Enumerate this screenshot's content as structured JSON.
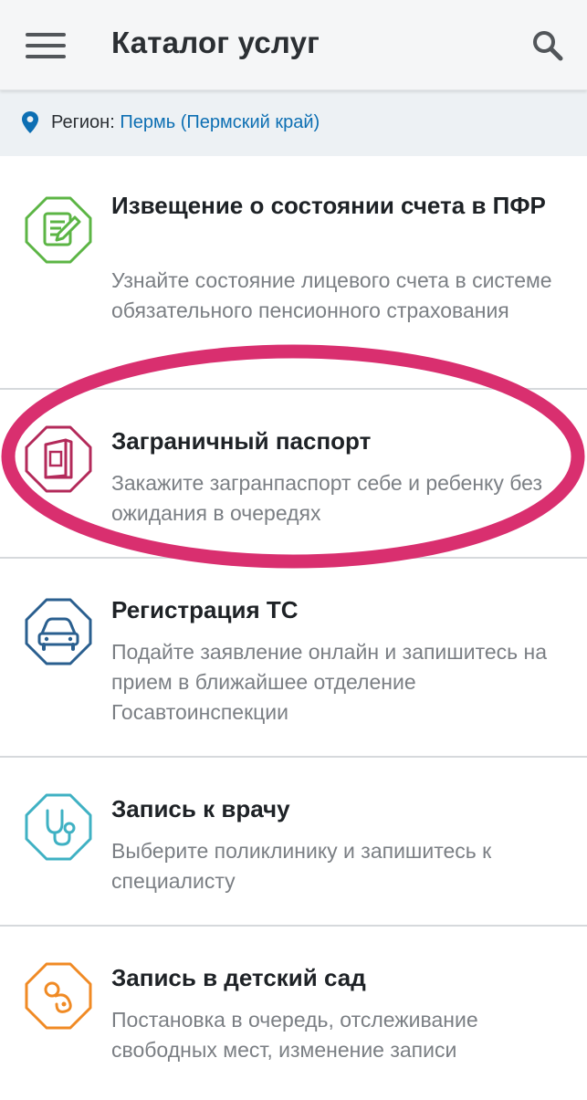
{
  "appbar": {
    "menu_icon": "hamburger-menu-icon",
    "title": "Каталог услуг",
    "search_icon": "search-icon"
  },
  "region": {
    "icon": "location-pin-icon",
    "label": "Регион:",
    "value": "Пермь (Пермский край)"
  },
  "services": [
    {
      "title": "Извещение о состоянии счета в ПФР",
      "description": "Узнайте состояние лицевого счета в системе обязательного пенсионного страхования",
      "icon": "document-edit-icon",
      "color": "#5cb545"
    },
    {
      "title": "Заграничный паспорт",
      "description": "Закажите загранпаспорт себе и ребенку без ожидания в очередях",
      "icon": "passport-icon",
      "color": "#b32a5a"
    },
    {
      "title": "Регистрация ТС",
      "description": "Подайте заявление онлайн и запишитесь на прием в ближайшее отделение Госавтоинспекции",
      "icon": "car-icon",
      "color": "#2a5f8f"
    },
    {
      "title": "Запись к врачу",
      "description": "Выберите поликлинику и запишитесь к специалисту",
      "icon": "stethoscope-icon",
      "color": "#3fb1c3"
    },
    {
      "title": "Запись в детский сад",
      "description": "Постановка в очередь, отслеживание свободных мест, изменение записи",
      "icon": "pacifier-icon",
      "color": "#f08a24"
    }
  ],
  "highlight_color": "#d92f6f"
}
